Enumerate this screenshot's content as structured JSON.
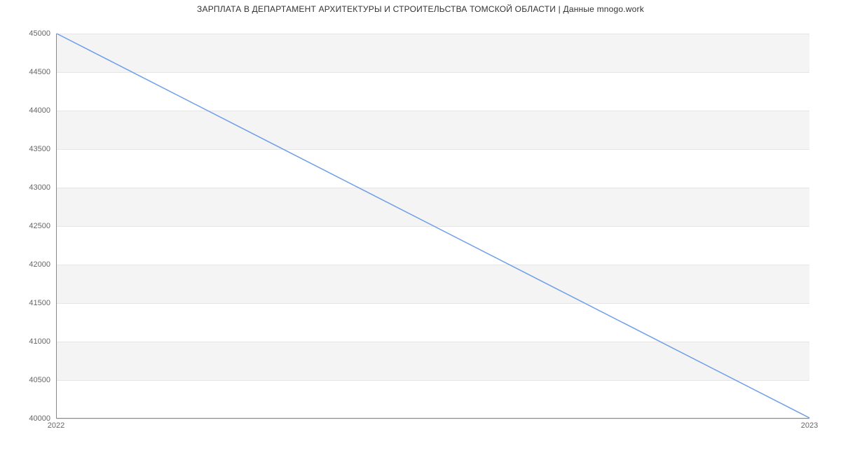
{
  "chart_data": {
    "type": "line",
    "title": "ЗАРПЛАТА В ДЕПАРТАМЕНТ АРХИТЕКТУРЫ И СТРОИТЕЛЬСТВА  ТОМСКОЙ ОБЛАСТИ | Данные mnogo.work",
    "xlabel": "",
    "ylabel": "",
    "x": [
      2022,
      2023
    ],
    "values": [
      45000,
      40000
    ],
    "ylim": [
      40000,
      45000
    ],
    "yticks": [
      40000,
      40500,
      41000,
      41500,
      42000,
      42500,
      43000,
      43500,
      44000,
      44500,
      45000
    ],
    "xticks": [
      2022,
      2023
    ],
    "bands_alternate": true,
    "colors": {
      "line": "#6f9fe8",
      "band": "#f4f4f4"
    }
  }
}
